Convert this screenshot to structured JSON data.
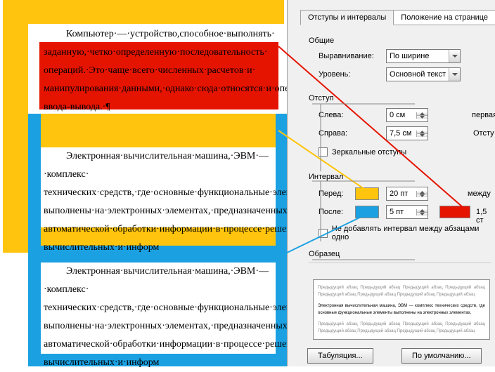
{
  "doc": {
    "para1": "Компьютер·—·устро",
    "para1b": "йство,способное·выполнять·",
    "para1c": "заданную,·четко·определ",
    "para1d": "енную·последовательность·",
    "para1e": "операций.·Это·чаще·вс",
    "para1f": "его·численных·расчетов·и·",
    "para1g": "манипулирования·данным",
    "para1h": "и,·однако·сюда·относятся·и·операции·",
    "para1i": "ввода-вывода.·¶",
    "para2": "Электронная·вычис",
    "para2b": "лительная·машина,·ЭВМ·—·комплекс·",
    "para2c": "технических·средств,·г",
    "para2d": "де·основные·функциональные·элементы·",
    "para2e": "выполнены·на·электрон",
    "para2f": "ных·элементах,·предназначенных·для·",
    "para2g": "автоматической·обработ",
    "para2h": "ки·информации·в·процессе·решения·",
    "para2i": "вычислительных·и·информ"
  },
  "dlg": {
    "tab1": "Отступы и интервалы",
    "tab2": "Положение на странице",
    "grp_general": "Общие",
    "lbl_align": "Выравнивание:",
    "val_align": "По ширине",
    "lbl_level": "Уровень:",
    "val_level": "Основной текст",
    "grp_indent": "Отступ",
    "lbl_left": "Слева:",
    "val_left": "0 см",
    "lbl_right": "Справа:",
    "val_right": "7,5 см",
    "lbl_first_trunc": "первая",
    "lbl_right_trunc": "Отсту",
    "chk_mirror": "Зеркальные отступы",
    "grp_interval": "Интервал",
    "lbl_before": "Перед:",
    "val_before": "20 пт",
    "lbl_after": "После:",
    "val_after": "5 пт",
    "lbl_between_trunc": "между",
    "val_linespace": "1,5 ст",
    "chk_noadd": "Не добавлять интервал между абзацами одно",
    "grp_sample": "Образец",
    "sample_gray": "Предыдущий абзац Предыдущий абзац Предыдущий абзац Предыдущий абзац Предыдущий абзац Предыдущий абзац Предыдущий абзац Предыдущий абзац",
    "sample_black": "Электронная вычислительная машина, ЭВМ — комплекс технических средств, где основные функциональные элементы выполнены на электронных элементах,",
    "btn_tabs": "Табуляция...",
    "btn_default": "По умолчанию..."
  }
}
